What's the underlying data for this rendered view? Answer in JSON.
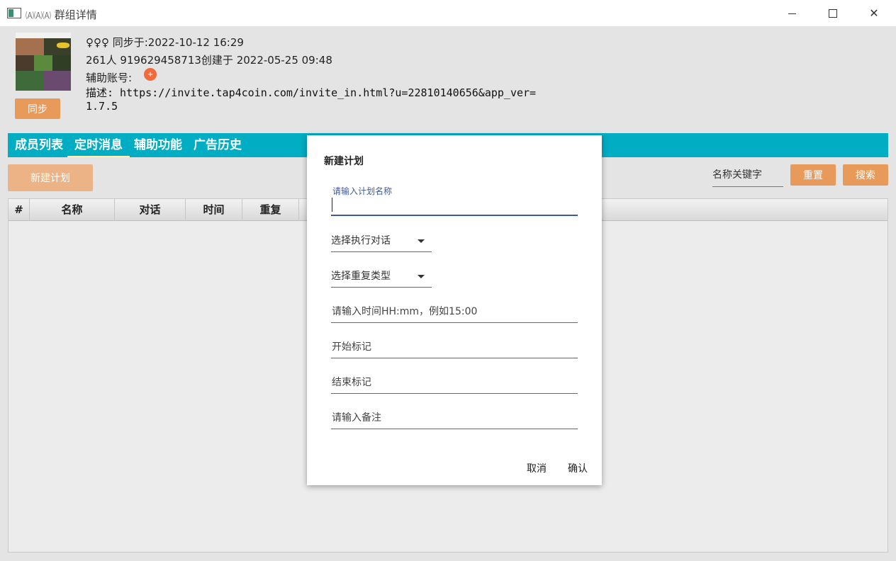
{
  "window": {
    "title": "群组详情",
    "title_icon_glyphs": "🄐🄐🄐"
  },
  "header": {
    "sync_label": "同步",
    "line1": "♀♀♀ 同步于:2022-10-12 16:29",
    "line2": "261人  919629458713创建于 2022-05-25 09:48",
    "line3": "辅助账号:",
    "add_symbol": "+",
    "description": "描述: https://invite.tap4coin.com/invite_in.html?u=22810140656&app_ver=1.7.5"
  },
  "tabs": [
    {
      "label": "成员列表"
    },
    {
      "label": "定时消息",
      "active": true
    },
    {
      "label": "辅助功能"
    },
    {
      "label": "广告历史"
    }
  ],
  "toolbar": {
    "new_plan_label": "新建计划",
    "search_placeholder": "名称关键字",
    "reset_label": "重置",
    "search_label": "搜索"
  },
  "table": {
    "columns": [
      "#",
      "名称",
      "对话",
      "时间",
      "重复"
    ]
  },
  "dialog": {
    "title": "新建计划",
    "name_label": "请输入计划名称",
    "chat_select": "选择执行对话",
    "repeat_select": "选择重复类型",
    "time_placeholder": "请输入时间HH:mm，例如15:00",
    "start_mark": "开始标记",
    "end_mark": "结束标记",
    "remark": "请输入备注",
    "cancel_label": "取消",
    "confirm_label": "确认"
  },
  "colors": {
    "tab_bar": "#00adc2",
    "accent_button": "#e89a5a",
    "add_circle": "#f06a3c",
    "focus_line": "#3f5a9a"
  }
}
